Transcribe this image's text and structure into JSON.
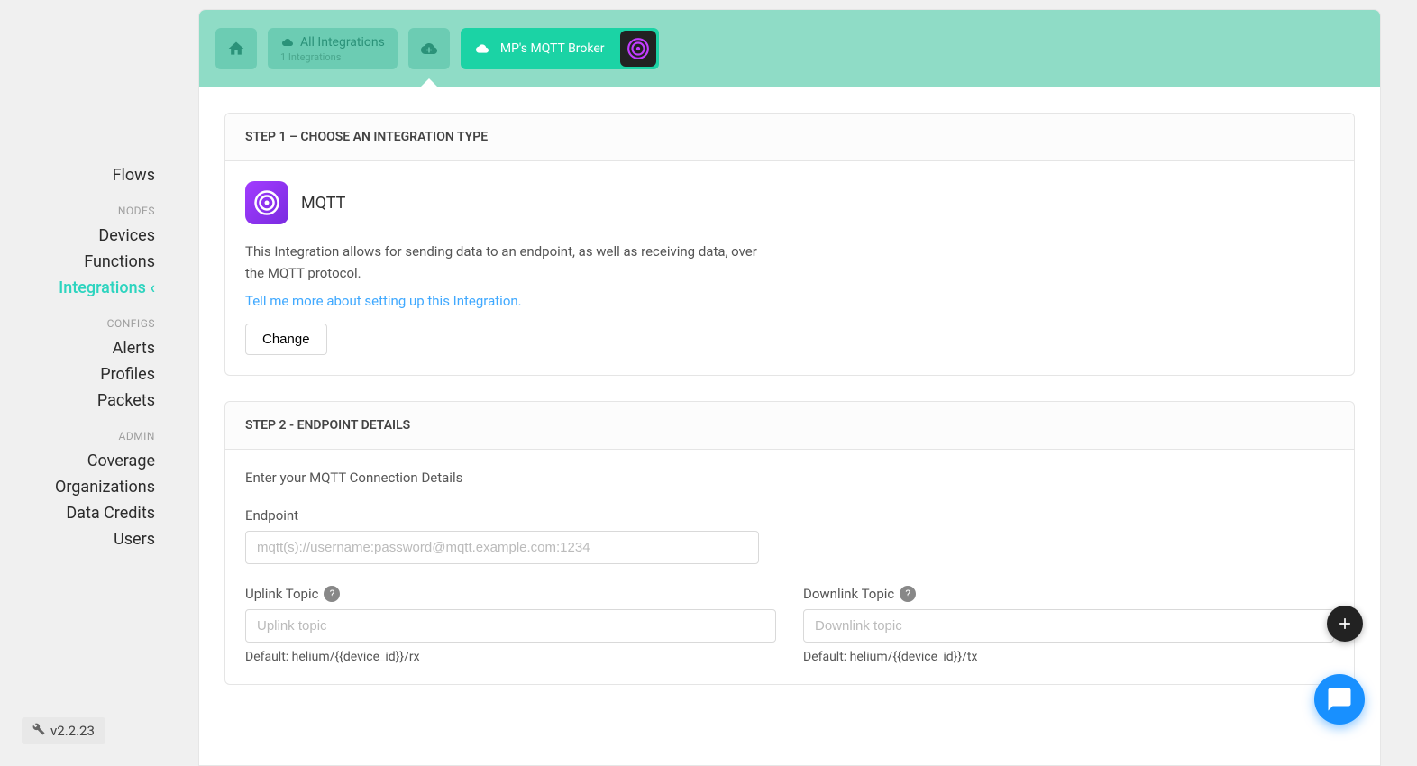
{
  "sidebar": {
    "flows": "Flows",
    "sections": {
      "nodes": "NODES",
      "configs": "CONFIGS",
      "admin": "ADMIN"
    },
    "items": {
      "devices": "Devices",
      "functions": "Functions",
      "integrations": "Integrations",
      "alerts": "Alerts",
      "profiles": "Profiles",
      "packets": "Packets",
      "coverage": "Coverage",
      "organizations": "Organizations",
      "data_credits": "Data Credits",
      "users": "Users"
    },
    "version": "v2.2.23"
  },
  "topbar": {
    "all_integrations_label": "All Integrations",
    "all_integrations_count": "1 Integrations",
    "mqtt_tab_label": "MP's MQTT Broker"
  },
  "step1": {
    "header": "STEP 1 – CHOOSE AN INTEGRATION TYPE",
    "type_name": "MQTT",
    "description": "This Integration allows for sending data to an endpoint, as well as receiving data, over the MQTT protocol.",
    "link_text": "Tell me more about setting up this Integration.",
    "change_button": "Change"
  },
  "step2": {
    "header": "STEP 2 - ENDPOINT DETAILS",
    "intro": "Enter your MQTT Connection Details",
    "endpoint_label": "Endpoint",
    "endpoint_placeholder": "mqtt(s)://username:password@mqtt.example.com:1234",
    "uplink_label": "Uplink Topic",
    "uplink_placeholder": "Uplink topic",
    "uplink_hint": "Default: helium/{{device_id}}/rx",
    "downlink_label": "Downlink Topic",
    "downlink_placeholder": "Downlink topic",
    "downlink_hint": "Default: helium/{{device_id}}/tx"
  }
}
